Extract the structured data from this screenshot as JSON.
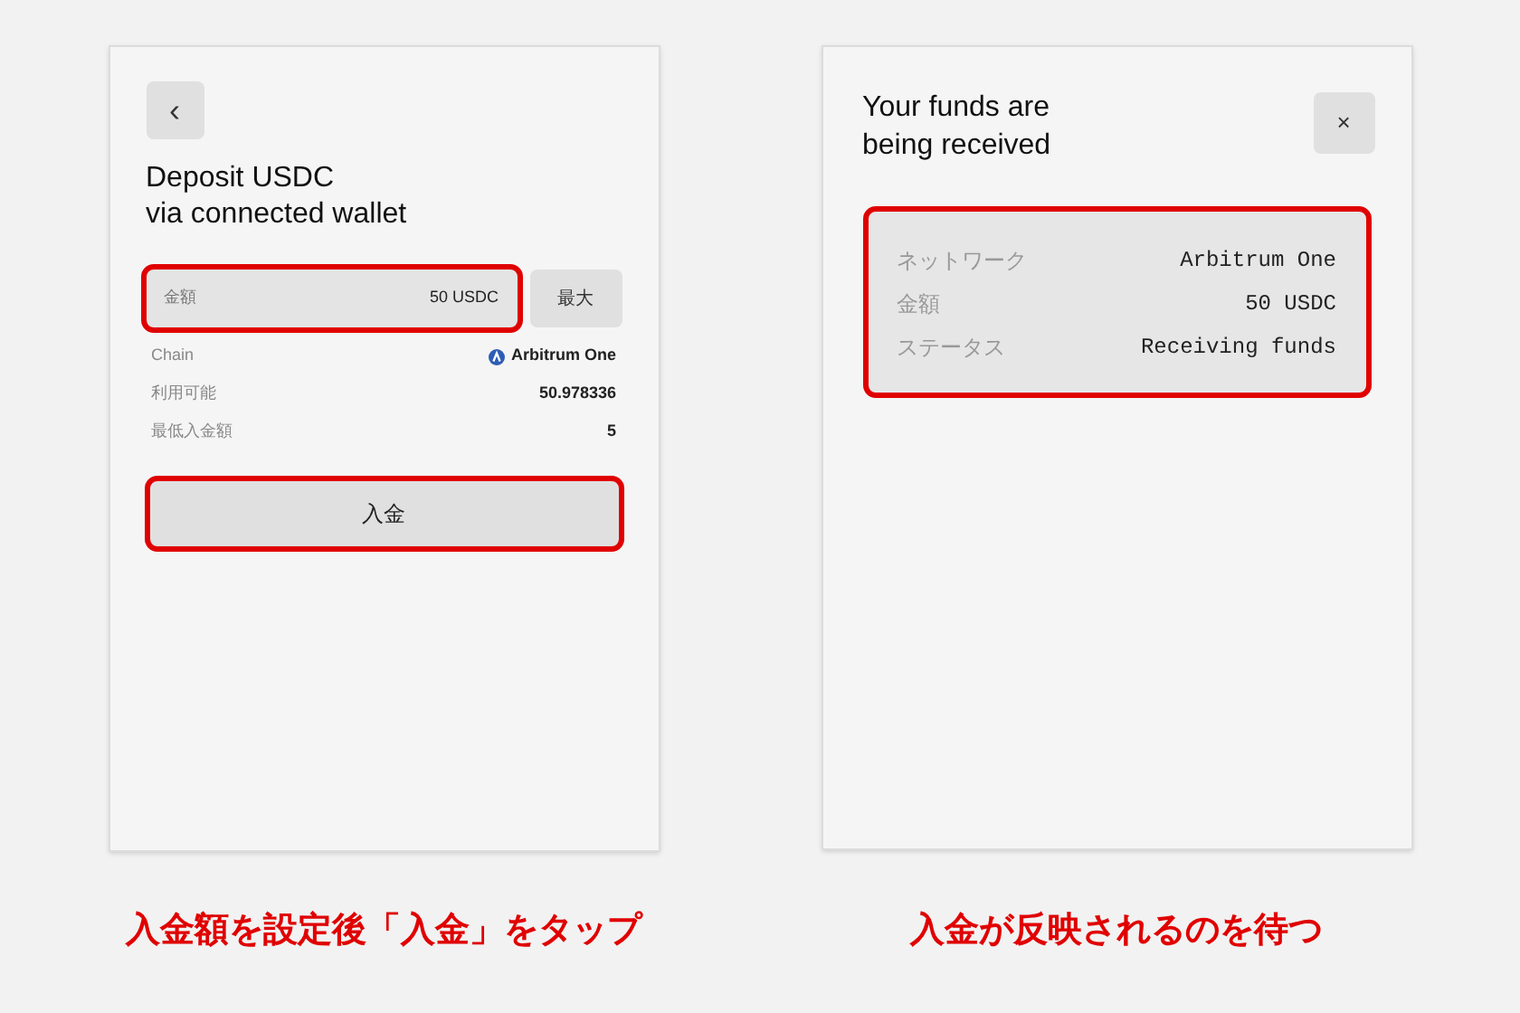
{
  "deposit_screen": {
    "back_button": "‹",
    "title": "Deposit USDC",
    "subtitle": "via connected wallet",
    "amount_field": {
      "label": "金額",
      "value": "50 USDC",
      "highlighted": true
    },
    "max_button": "最大",
    "rows": [
      {
        "label": "Chain",
        "value": "Arbitrum One",
        "kind": "network"
      },
      {
        "label": "利用可能",
        "value": "50.978336",
        "kind": "plain"
      },
      {
        "label": "最低入金額",
        "value": "5",
        "kind": "plain"
      }
    ],
    "deposit_button": {
      "label": "入金",
      "highlighted": true
    },
    "caption": "入金額を設定後「入金」をタップ"
  },
  "status_screen": {
    "title": "Your funds are",
    "subtitle": "being received",
    "close_button": "×",
    "details": {
      "highlighted": true,
      "rows": [
        {
          "label": "ネットワーク",
          "value": "Arbitrum One"
        },
        {
          "label": "金額",
          "value": "50 USDC"
        },
        {
          "label": "ステータス",
          "value": "Receiving funds"
        }
      ]
    },
    "caption": "入金が反映されるのを待つ"
  }
}
